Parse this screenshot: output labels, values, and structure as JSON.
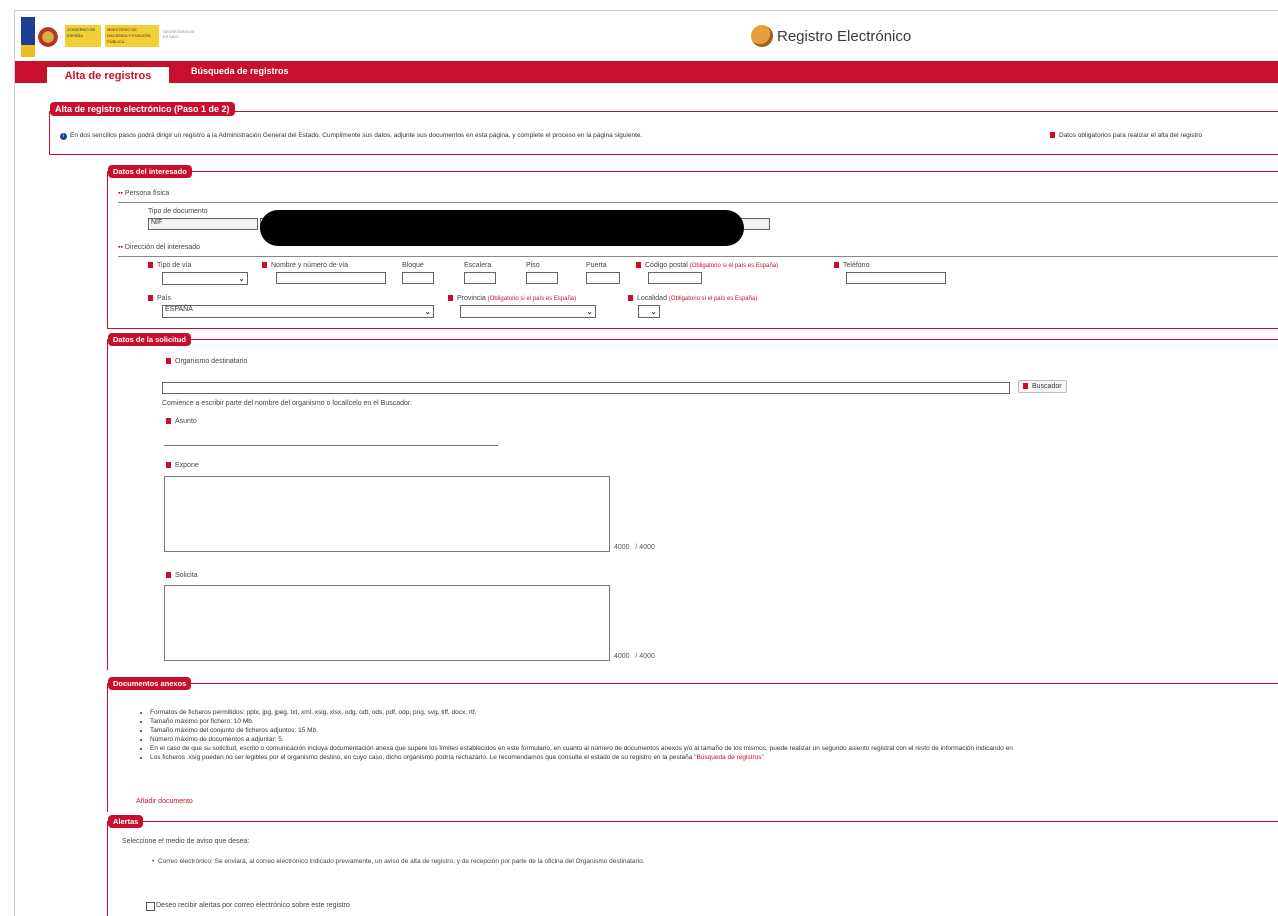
{
  "header": {
    "gov_line1": "GOBIERNO DE ESPAÑA",
    "ministry": "MINISTERIO DE HACIENDA Y FUNCIÓN PÚBLICA",
    "secretaria": "SECRETARÍA DE ESTADO",
    "app_title": "Registro Electrónico"
  },
  "tabs": {
    "active": "Alta de registros",
    "other": "Búsqueda de registros"
  },
  "main_panel": {
    "legend": "Alta de registro electrónico (Paso 1 de 2)",
    "intro": "En dos sencillos pasos podrá dirigir un registro a la Administración General del Estado. Cumplimente sus datos, adjunte sus documentos en esta página, y complete el proceso en la página siguiente.",
    "required_note": "Datos obligatorios para realizar el alta del registro"
  },
  "interesado": {
    "legend": "Datos del interesado",
    "persona_label": "Persona física",
    "tipo_doc_label": "Tipo de documento",
    "tipo_doc_value": "NIF",
    "direccion_label": "Dirección del interesado",
    "tipo_via_label": "Tipo de vía",
    "nombre_via_label": "Nombre y número de vía",
    "bloque_label": "Bloque",
    "escalera_label": "Escalera",
    "piso_label": "Piso",
    "puerta_label": "Puerta",
    "cp_label": "Código postal",
    "cp_note": "(Obligatorio si el país es España)",
    "telefono_label": "Teléfono",
    "pais_label": "País",
    "pais_value": "ESPAÑA",
    "provincia_label": "Provincia",
    "provincia_note": "(Obligatorio si el país es España)",
    "localidad_label": "Localidad",
    "localidad_note": "(Obligatorio si el país es España)"
  },
  "solicitud": {
    "legend": "Datos de la solicitud",
    "organismo_label": "Organismo destinatario",
    "buscador_label": "Buscador",
    "organismo_help": "Comience a escribir parte del nombre del organismo o localícelo en el Buscador.",
    "asunto_label": "Asunto",
    "expone_label": "Expone",
    "expone_count": "4000",
    "expone_max": "/ 4000",
    "solicita_label": "Solicita",
    "solicita_count": "4000",
    "solicita_max": "/ 4000"
  },
  "documentos": {
    "legend": "Documentos anexos",
    "items": [
      "Formatos de ficheros permitidos: pptx, jpg, jpeg, txt, xml, xsig, xlsx, odg, odt, ods, pdf, odp, png, svg, tiff, docx, rtf.",
      "Tamaño máximo por fichero: 10 Mb.",
      "Tamaño máximo del conjunto de ficheros adjuntos: 15 Mb.",
      "Número máximo de documentos a adjuntar: 5.",
      "En el caso de que su solicitud, escrito o comunicación incluya documentación anexa que supere los límites establecidos en este formulario, en cuanto al número de documentos anexos y/o al tamaño de los mismos, puede realizar un segundo asiento registral con el resto de información indicando en",
      "Los ficheros .xsig pueden no ser legibles por el organismo destino, en cuyo caso, dicho organismo podría rechazarlo. Le recomendamos que consulte el estado de su registro en la pestaña"
    ],
    "busqueda_link": "\"Búsqueda de registros\"",
    "add_link": "Añadir documento"
  },
  "alertas": {
    "legend": "Alertas",
    "intro": "Seleccione el medio de aviso que desea:",
    "email_item": "Correo electrónico: Se enviará, al correo electrónico indicado previamente, un aviso de alta de registro, y de recepción por parte de la oficina del Organismo destinatario.",
    "checkbox_label": "Deseo recibir alertas por correo electrónico sobre este registro"
  },
  "colors": {
    "brand_red": "#c8102e",
    "flag_yellow": "#f2cf35"
  }
}
